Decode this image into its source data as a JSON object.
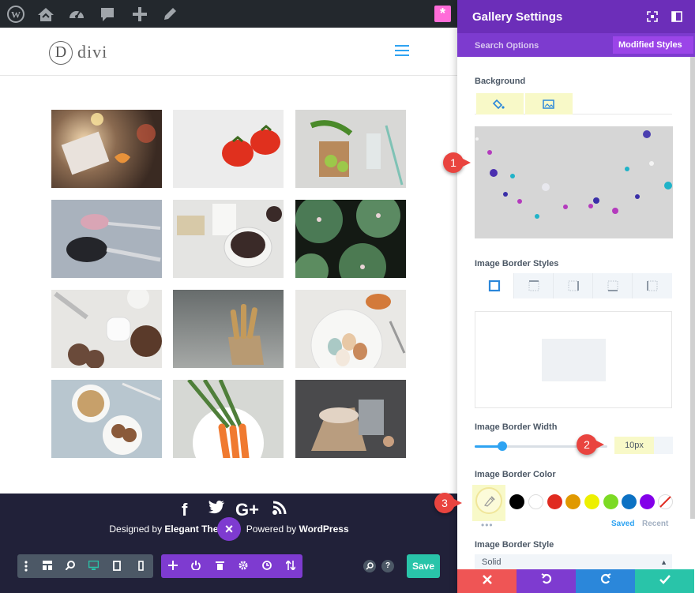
{
  "site": {
    "logo_letter": "D",
    "logo_text": "divi"
  },
  "adminbar": {
    "icons": [
      "wordpress-icon",
      "dashboard-home-icon",
      "customize-icon",
      "comments-icon",
      "add-new-icon",
      "edit-icon"
    ],
    "badge": "*"
  },
  "footer": {
    "social": [
      "f",
      "t",
      "G+",
      "rss"
    ],
    "designed_by": "Designed by ",
    "designer": "Elegant The",
    "powered_by": " Powered by ",
    "platform": "WordPress"
  },
  "builder": {
    "save_label": "Save",
    "close_label": "×",
    "help_label": "?"
  },
  "panel": {
    "title": "Gallery Settings",
    "search_options": "Search Options",
    "modified_styles": "Modified Styles",
    "modified_close": "×",
    "background_label": "Background",
    "border_styles_label": "Image Border Styles",
    "border_width_label": "Image Border Width",
    "border_width_value": "10px",
    "border_width_fraction": 0.21,
    "border_color_label": "Image Border Color",
    "saved_label": "Saved",
    "recent_label": "Recent",
    "dots": "•••",
    "border_style_label": "Image Border Style",
    "border_style_value": "Solid"
  },
  "swatches": [
    "#000000",
    "#ffffff",
    "#e02b20",
    "#e09900",
    "#edf000",
    "#7cda24",
    "#0c71c3",
    "#8300e9"
  ],
  "colors": {
    "accent_purple": "#6c2eb9",
    "accent_blue": "#2ea3f2",
    "save_green": "#29c4a9",
    "highlight": "#f8f9c8",
    "callout_red": "#e9443f"
  },
  "callouts": [
    "1",
    "2",
    "3"
  ],
  "actions": [
    "close-icon",
    "undo-icon",
    "redo-icon",
    "check-icon"
  ]
}
